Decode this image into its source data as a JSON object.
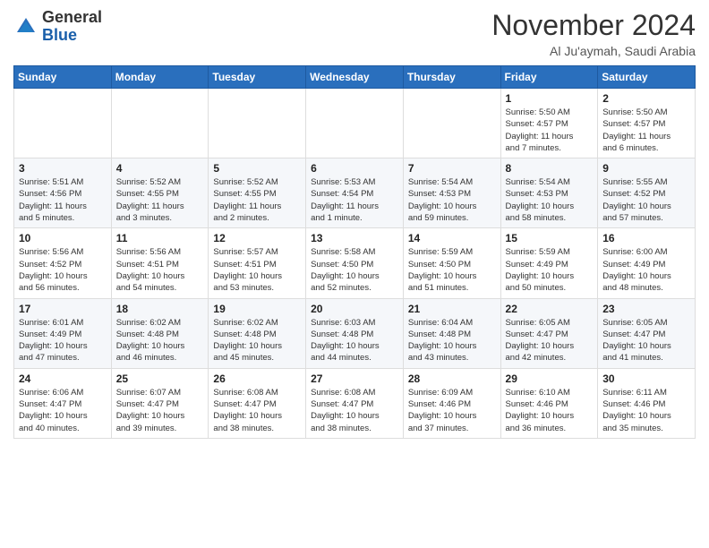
{
  "logo": {
    "general": "General",
    "blue": "Blue"
  },
  "header": {
    "month": "November 2024",
    "location": "Al Ju'aymah, Saudi Arabia"
  },
  "weekdays": [
    "Sunday",
    "Monday",
    "Tuesday",
    "Wednesday",
    "Thursday",
    "Friday",
    "Saturday"
  ],
  "weeks": [
    [
      {
        "day": "",
        "detail": ""
      },
      {
        "day": "",
        "detail": ""
      },
      {
        "day": "",
        "detail": ""
      },
      {
        "day": "",
        "detail": ""
      },
      {
        "day": "",
        "detail": ""
      },
      {
        "day": "1",
        "detail": "Sunrise: 5:50 AM\nSunset: 4:57 PM\nDaylight: 11 hours\nand 7 minutes."
      },
      {
        "day": "2",
        "detail": "Sunrise: 5:50 AM\nSunset: 4:57 PM\nDaylight: 11 hours\nand 6 minutes."
      }
    ],
    [
      {
        "day": "3",
        "detail": "Sunrise: 5:51 AM\nSunset: 4:56 PM\nDaylight: 11 hours\nand 5 minutes."
      },
      {
        "day": "4",
        "detail": "Sunrise: 5:52 AM\nSunset: 4:55 PM\nDaylight: 11 hours\nand 3 minutes."
      },
      {
        "day": "5",
        "detail": "Sunrise: 5:52 AM\nSunset: 4:55 PM\nDaylight: 11 hours\nand 2 minutes."
      },
      {
        "day": "6",
        "detail": "Sunrise: 5:53 AM\nSunset: 4:54 PM\nDaylight: 11 hours\nand 1 minute."
      },
      {
        "day": "7",
        "detail": "Sunrise: 5:54 AM\nSunset: 4:53 PM\nDaylight: 10 hours\nand 59 minutes."
      },
      {
        "day": "8",
        "detail": "Sunrise: 5:54 AM\nSunset: 4:53 PM\nDaylight: 10 hours\nand 58 minutes."
      },
      {
        "day": "9",
        "detail": "Sunrise: 5:55 AM\nSunset: 4:52 PM\nDaylight: 10 hours\nand 57 minutes."
      }
    ],
    [
      {
        "day": "10",
        "detail": "Sunrise: 5:56 AM\nSunset: 4:52 PM\nDaylight: 10 hours\nand 56 minutes."
      },
      {
        "day": "11",
        "detail": "Sunrise: 5:56 AM\nSunset: 4:51 PM\nDaylight: 10 hours\nand 54 minutes."
      },
      {
        "day": "12",
        "detail": "Sunrise: 5:57 AM\nSunset: 4:51 PM\nDaylight: 10 hours\nand 53 minutes."
      },
      {
        "day": "13",
        "detail": "Sunrise: 5:58 AM\nSunset: 4:50 PM\nDaylight: 10 hours\nand 52 minutes."
      },
      {
        "day": "14",
        "detail": "Sunrise: 5:59 AM\nSunset: 4:50 PM\nDaylight: 10 hours\nand 51 minutes."
      },
      {
        "day": "15",
        "detail": "Sunrise: 5:59 AM\nSunset: 4:49 PM\nDaylight: 10 hours\nand 50 minutes."
      },
      {
        "day": "16",
        "detail": "Sunrise: 6:00 AM\nSunset: 4:49 PM\nDaylight: 10 hours\nand 48 minutes."
      }
    ],
    [
      {
        "day": "17",
        "detail": "Sunrise: 6:01 AM\nSunset: 4:49 PM\nDaylight: 10 hours\nand 47 minutes."
      },
      {
        "day": "18",
        "detail": "Sunrise: 6:02 AM\nSunset: 4:48 PM\nDaylight: 10 hours\nand 46 minutes."
      },
      {
        "day": "19",
        "detail": "Sunrise: 6:02 AM\nSunset: 4:48 PM\nDaylight: 10 hours\nand 45 minutes."
      },
      {
        "day": "20",
        "detail": "Sunrise: 6:03 AM\nSunset: 4:48 PM\nDaylight: 10 hours\nand 44 minutes."
      },
      {
        "day": "21",
        "detail": "Sunrise: 6:04 AM\nSunset: 4:48 PM\nDaylight: 10 hours\nand 43 minutes."
      },
      {
        "day": "22",
        "detail": "Sunrise: 6:05 AM\nSunset: 4:47 PM\nDaylight: 10 hours\nand 42 minutes."
      },
      {
        "day": "23",
        "detail": "Sunrise: 6:05 AM\nSunset: 4:47 PM\nDaylight: 10 hours\nand 41 minutes."
      }
    ],
    [
      {
        "day": "24",
        "detail": "Sunrise: 6:06 AM\nSunset: 4:47 PM\nDaylight: 10 hours\nand 40 minutes."
      },
      {
        "day": "25",
        "detail": "Sunrise: 6:07 AM\nSunset: 4:47 PM\nDaylight: 10 hours\nand 39 minutes."
      },
      {
        "day": "26",
        "detail": "Sunrise: 6:08 AM\nSunset: 4:47 PM\nDaylight: 10 hours\nand 38 minutes."
      },
      {
        "day": "27",
        "detail": "Sunrise: 6:08 AM\nSunset: 4:47 PM\nDaylight: 10 hours\nand 38 minutes."
      },
      {
        "day": "28",
        "detail": "Sunrise: 6:09 AM\nSunset: 4:46 PM\nDaylight: 10 hours\nand 37 minutes."
      },
      {
        "day": "29",
        "detail": "Sunrise: 6:10 AM\nSunset: 4:46 PM\nDaylight: 10 hours\nand 36 minutes."
      },
      {
        "day": "30",
        "detail": "Sunrise: 6:11 AM\nSunset: 4:46 PM\nDaylight: 10 hours\nand 35 minutes."
      }
    ]
  ]
}
